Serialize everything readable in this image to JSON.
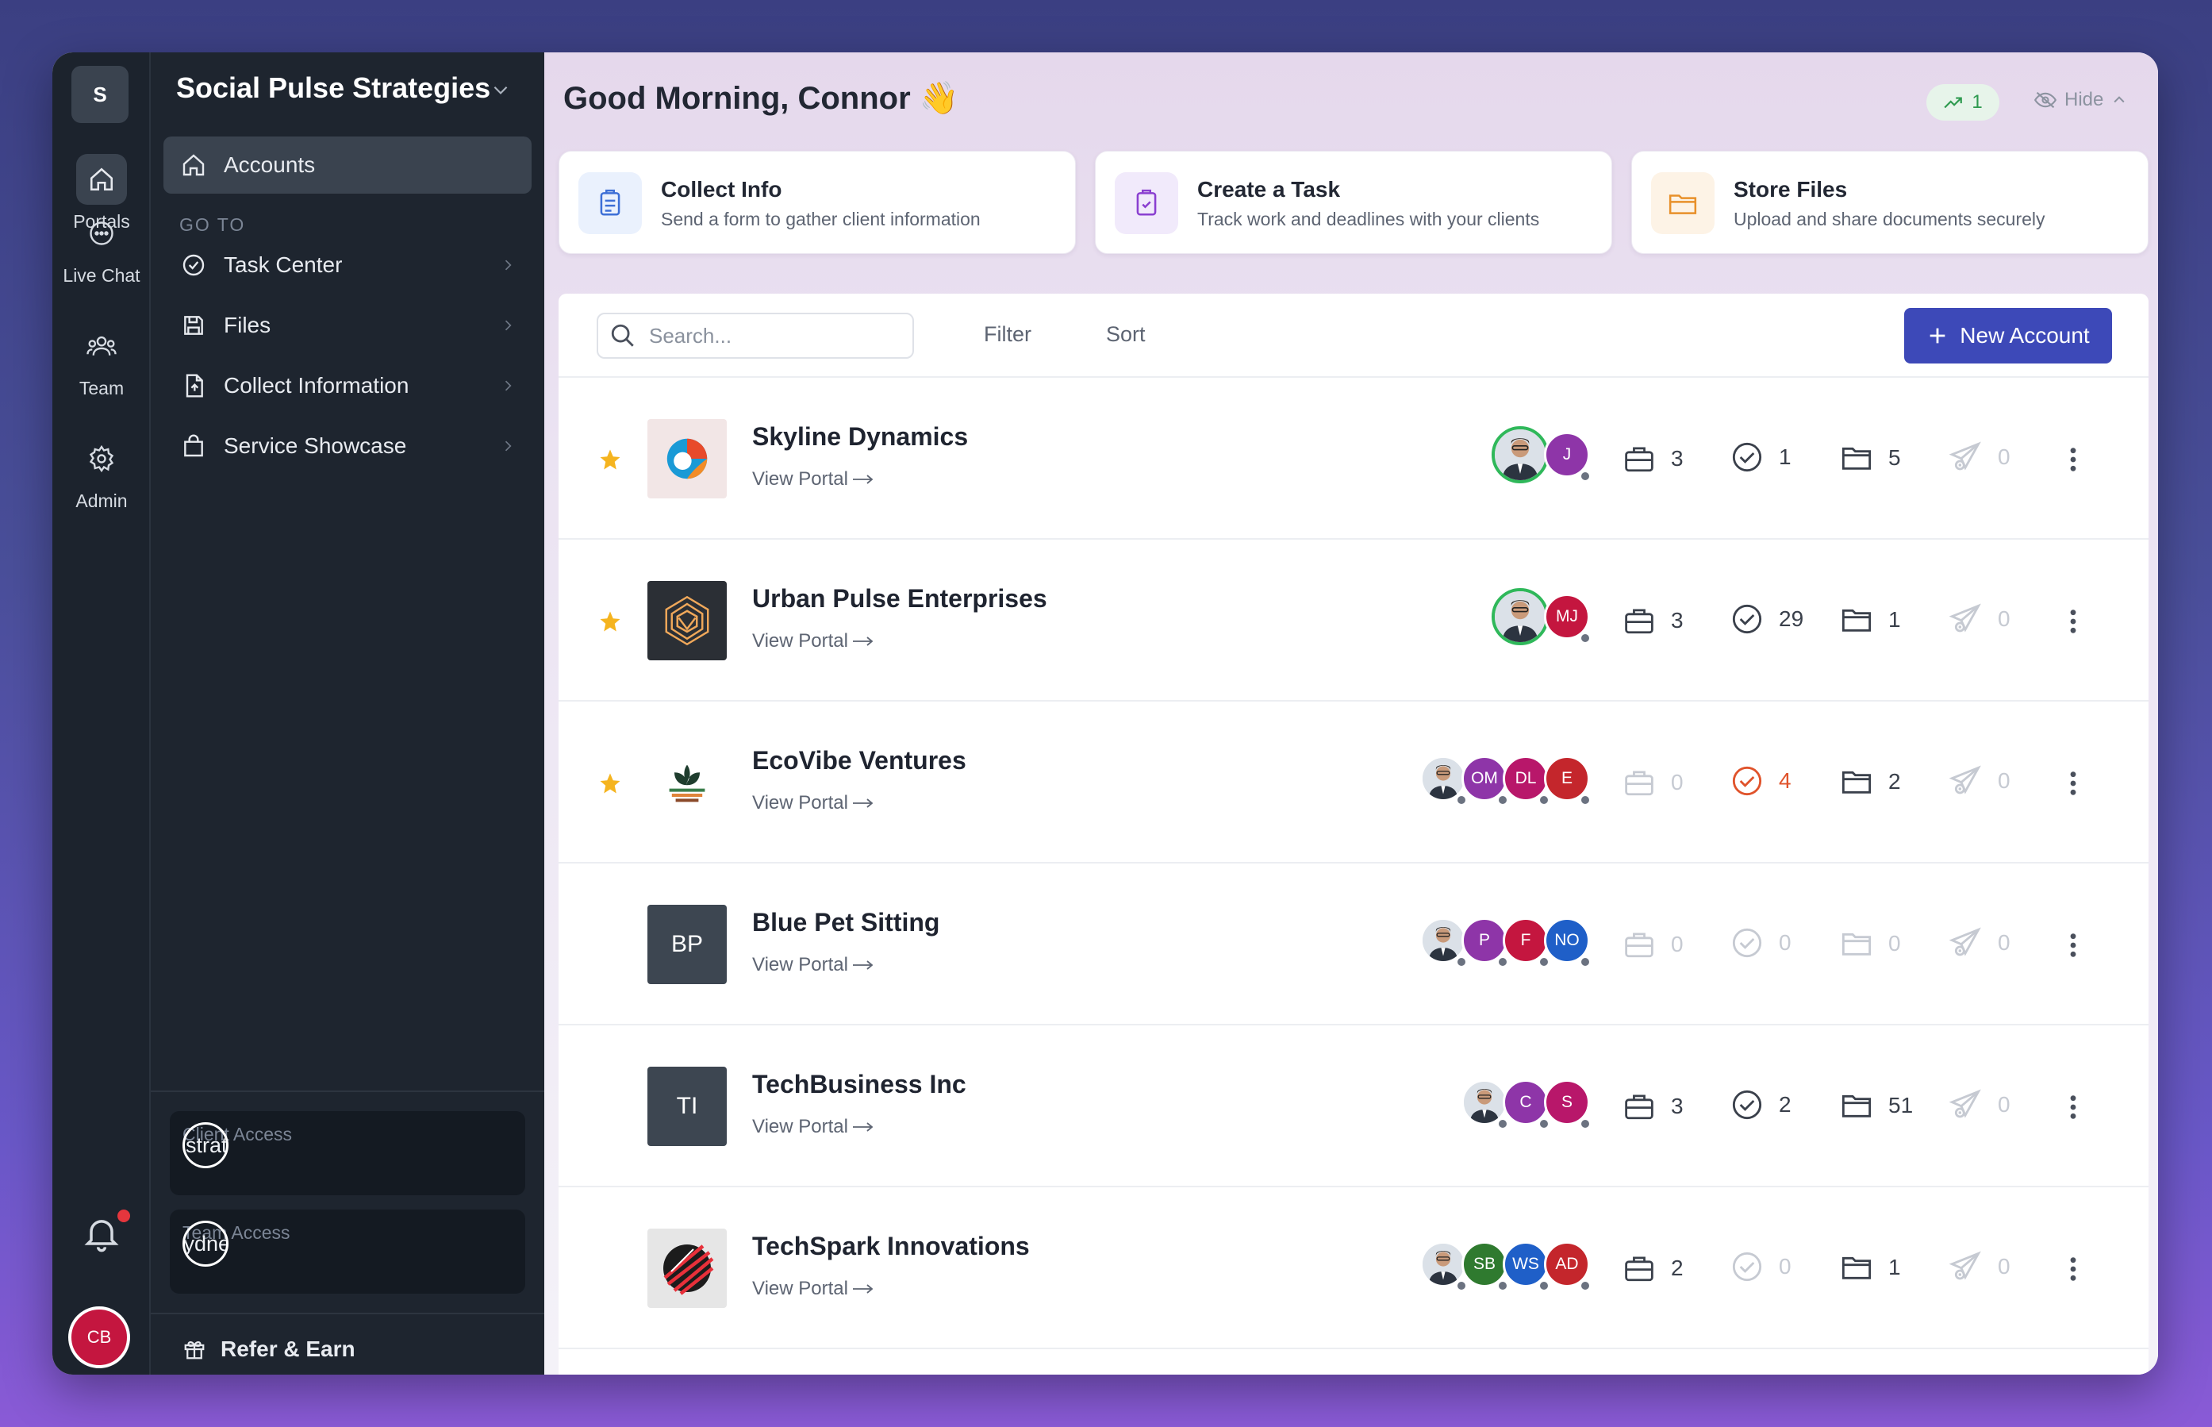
{
  "workspace": {
    "initial": "S",
    "name": "Social Pulse Strategies"
  },
  "rail": {
    "items": [
      {
        "label": "Portals"
      },
      {
        "label": "Live Chat"
      },
      {
        "label": "Team"
      },
      {
        "label": "Admin"
      }
    ],
    "user_initials": "CB"
  },
  "nav": {
    "active_item": "Accounts",
    "goto_label": "GO TO",
    "items": [
      {
        "label": "Task Center"
      },
      {
        "label": "Files"
      },
      {
        "label": "Collect Information"
      },
      {
        "label": "Service Showcase"
      }
    ],
    "client_access": {
      "label": "Client Access",
      "value": "socialpulsestrat.sydnee.app"
    },
    "team_access": {
      "label": "Team Access",
      "value": "my.sydnee.app"
    },
    "refer_label": "Refer & Earn"
  },
  "header": {
    "greeting": "Good Morning, Connor 👋",
    "trend_count": "1",
    "hide_label": "Hide"
  },
  "quick_actions": [
    {
      "title": "Collect Info",
      "subtitle": "Send a form to gather client information",
      "icon": "clipboard-icon",
      "color": "#3d6fd6",
      "bg": "#eaf1fd"
    },
    {
      "title": "Create a Task",
      "subtitle": "Track work and deadlines with your clients",
      "icon": "task-clipboard-icon",
      "color": "#8a3fd0",
      "bg": "#f1eafb"
    },
    {
      "title": "Store Files",
      "subtitle": "Upload and share documents securely",
      "icon": "folder-icon",
      "color": "#e8902a",
      "bg": "#fdf3e6"
    }
  ],
  "toolbar": {
    "search_placeholder": "Search...",
    "filter_label": "Filter",
    "sort_label": "Sort",
    "new_account_label": "New Account"
  },
  "accounts": [
    {
      "name": "Skyline Dynamics",
      "link": "View Portal",
      "starred": true,
      "logo": "skyline-logo",
      "members": [
        {
          "type": "photo",
          "ring": true
        },
        {
          "initials": "J",
          "color": "#8e35a8"
        }
      ],
      "projects": "3",
      "tasks": "1",
      "files": "5",
      "messages": "0"
    },
    {
      "name": "Urban Pulse Enterprises",
      "link": "View Portal",
      "starred": true,
      "logo": "urban-logo",
      "members": [
        {
          "type": "photo",
          "ring": true
        },
        {
          "initials": "MJ",
          "color": "#c4163f"
        }
      ],
      "projects": "3",
      "tasks": "29",
      "files": "1",
      "messages": "0"
    },
    {
      "name": "EcoVibe Ventures",
      "link": "View Portal",
      "starred": true,
      "logo": "ecovibe-logo",
      "members": [
        {
          "type": "photo"
        },
        {
          "initials": "OM",
          "color": "#8e35a8"
        },
        {
          "initials": "DL",
          "color": "#b8176a"
        },
        {
          "initials": "E",
          "color": "#c4262c"
        }
      ],
      "projects": "0",
      "tasks": "4",
      "files": "2",
      "messages": "0"
    },
    {
      "name": "Blue Pet Sitting",
      "link": "View Portal",
      "starred": false,
      "logo_text": "BP",
      "members": [
        {
          "type": "photo"
        },
        {
          "initials": "P",
          "color": "#8e35a8"
        },
        {
          "initials": "F",
          "color": "#c4163f"
        },
        {
          "initials": "NO",
          "color": "#1f5fc8"
        }
      ],
      "projects": "0",
      "tasks": "0",
      "files": "0",
      "messages": "0"
    },
    {
      "name": "TechBusiness Inc",
      "link": "View Portal",
      "starred": false,
      "logo_text": "TI",
      "members": [
        {
          "type": "photo"
        },
        {
          "initials": "C",
          "color": "#8e35a8"
        },
        {
          "initials": "S",
          "color": "#b8176a"
        }
      ],
      "projects": "3",
      "tasks": "2",
      "files": "51",
      "messages": "0"
    },
    {
      "name": "TechSpark Innovations",
      "link": "View Portal",
      "starred": false,
      "logo": "techspark-logo",
      "members": [
        {
          "type": "photo"
        },
        {
          "initials": "SB",
          "color": "#2f7a2f"
        },
        {
          "initials": "WS",
          "color": "#1f5fc8"
        },
        {
          "initials": "AD",
          "color": "#c4262c"
        }
      ],
      "projects": "2",
      "tasks": "0",
      "files": "1",
      "messages": "0"
    }
  ]
}
